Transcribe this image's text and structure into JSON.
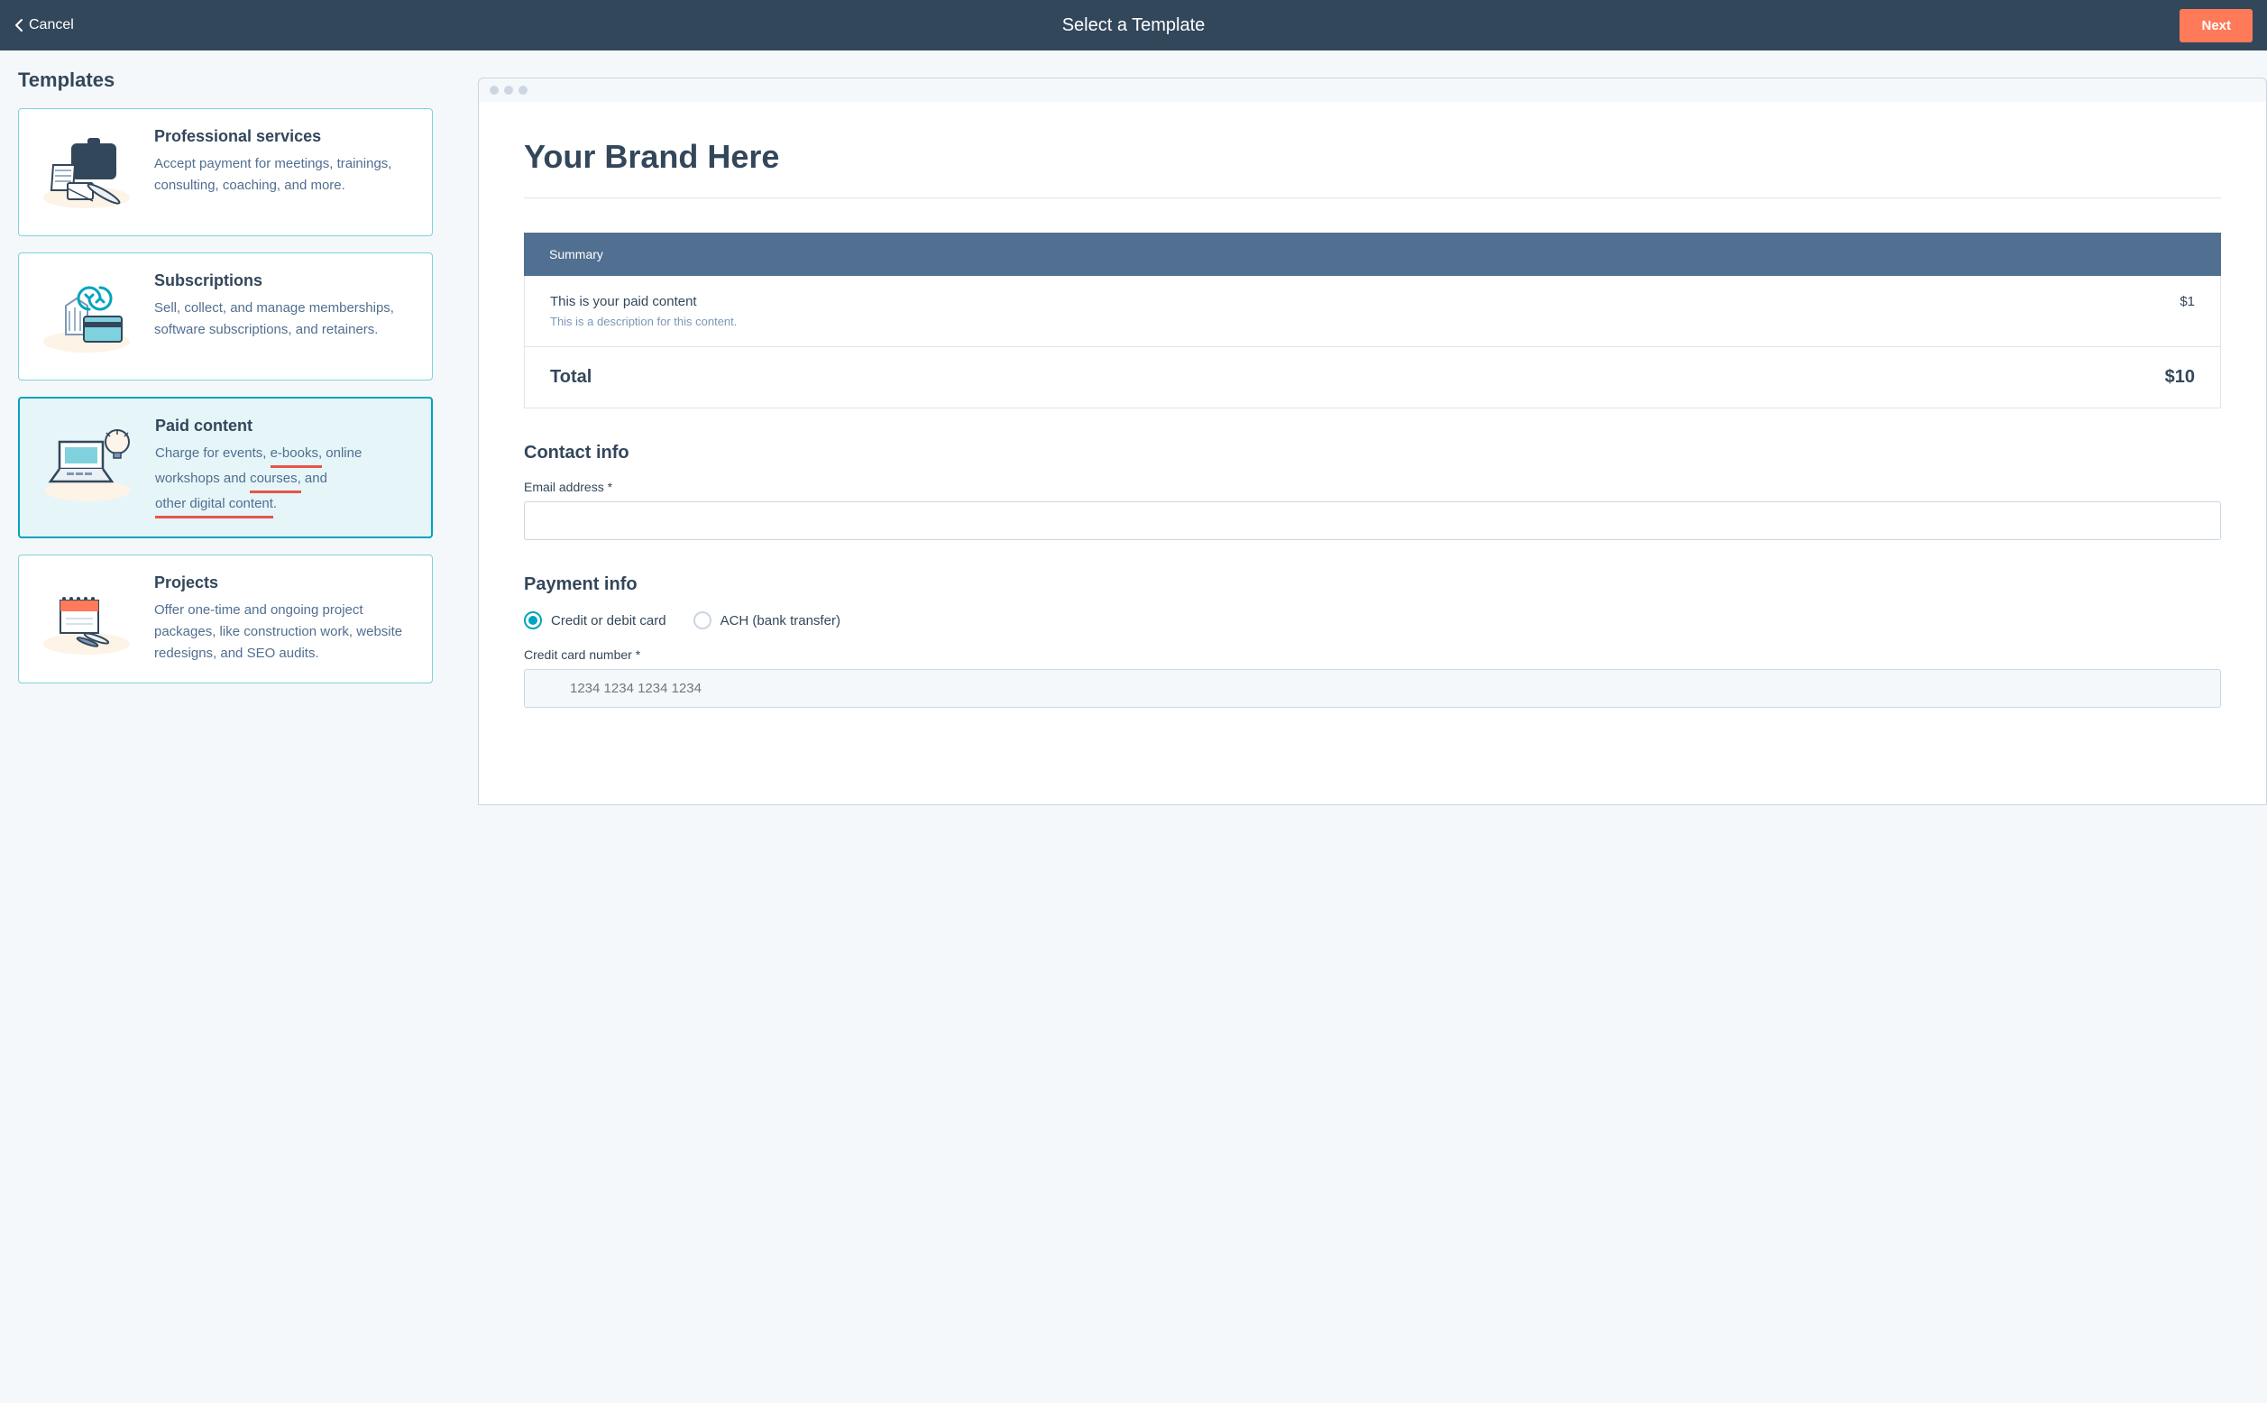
{
  "header": {
    "cancel_label": "Cancel",
    "title": "Select a Template",
    "next_label": "Next"
  },
  "sidebar": {
    "title": "Templates",
    "templates": [
      {
        "title": "Professional services",
        "desc": "Accept payment for meetings, trainings, consulting, coaching, and more.",
        "selected": false
      },
      {
        "title": "Subscriptions",
        "desc": "Sell, collect, and manage memberships, software subscriptions, and retainers.",
        "selected": false
      },
      {
        "title": "Paid content",
        "desc_pre": "Charge for events, ",
        "desc_u1": "e-books,",
        "desc_mid1": " online workshops and ",
        "desc_u2": "courses,",
        "desc_mid2": " and ",
        "desc_u3": "other digital content",
        "desc_post": ".",
        "selected": true
      },
      {
        "title": "Projects",
        "desc": "Offer one-time and ongoing project packages, like construction work, website redesigns, and SEO audits.",
        "selected": false
      }
    ]
  },
  "preview": {
    "brand_title": "Your Brand Here",
    "summary_label": "Summary",
    "item_title": "This is your paid content",
    "item_desc": "This is a description for this content.",
    "item_price": "$1",
    "total_label": "Total",
    "total_value": "$10",
    "contact_title": "Contact info",
    "email_label": "Email address *",
    "payment_title": "Payment info",
    "radio_cc": "Credit or debit card",
    "radio_ach": "ACH (bank transfer)",
    "cc_label": "Credit card number *",
    "cc_placeholder": "1234 1234 1234 1234"
  }
}
